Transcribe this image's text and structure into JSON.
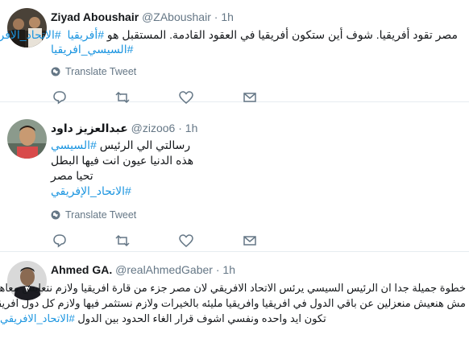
{
  "colors": {
    "link": "#1b95e0",
    "secondary": "#657786",
    "text": "#14171a",
    "border": "#e6ecf0"
  },
  "tweets": [
    {
      "name": "Ziyad Aboushair",
      "handle": "@ZAboushair",
      "time": "1h",
      "line1_text": "مصر تقود أفريقيا. شوف أين ستكون أفريقيا في العقود القادمة. المستقبل هو ",
      "line1_tags": [
        "#أفريقيا",
        "#الاتحاد_الافريقي"
      ],
      "line2_tag": "#السيسي_افريقيا",
      "translate": "Translate Tweet"
    },
    {
      "name": "عبدالعزيز داود",
      "handle": "@zizoo6",
      "time": "1h",
      "line1_text": "رسالتي الي الرئيس ",
      "line1_tag": "#السيسي",
      "line2": "هذه الدنيا عيون انت فيها البطل",
      "line3": "تحيا مصر",
      "line4_tag": "#الاتحاد_الإفريقي",
      "translate": "Translate Tweet"
    },
    {
      "name": "Ahmed GA.",
      "handle": "@realAhmedGaber",
      "time": "1h",
      "line1": "خطوة جميلة جدا ان الرئيس السيسي يرئس الاتحاد الافريقي لان مصر جزء من قارة افريقيا ولازم نتعايش معاهم",
      "line2": "مش هنعيش منعزلين عن باقي الدول في افريقيا وافريقيا مليئه بالخيرات ولازم نستثمر فيها ولازم كل دول افريقيا",
      "line3_text": "تكون ايد واحده ونفسي اشوف قرار الغاء الحدود  بين الدول ",
      "line3_tag": "#الاتحاد_الافريقي"
    }
  ]
}
